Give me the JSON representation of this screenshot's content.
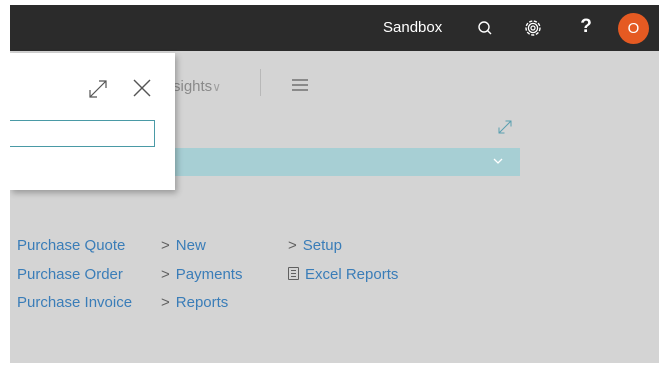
{
  "topbar": {
    "environment": "Sandbox",
    "icons": [
      "search-icon",
      "settings-icon",
      "help-icon"
    ],
    "help_glyph": "?",
    "avatar_initial": "O",
    "avatar_color": "#e55a22"
  },
  "actionbar": {
    "insights_label": "sights",
    "insights_chevron": "∨"
  },
  "menus": {
    "col1": [
      "Purchase Quote",
      "Purchase Order",
      "Purchase Invoice"
    ],
    "col2": [
      "New",
      "Payments",
      "Reports"
    ],
    "col3_group": "Setup",
    "col3_report": "Excel Reports",
    "group_marker": ">"
  },
  "dialog": {
    "search_value": "",
    "search_placeholder": ""
  },
  "colors": {
    "topbar_bg": "#2b2b2b",
    "page_bg": "#d4d4d4",
    "accent_teal": "#a7cfd4",
    "link": "#3a7db8"
  }
}
